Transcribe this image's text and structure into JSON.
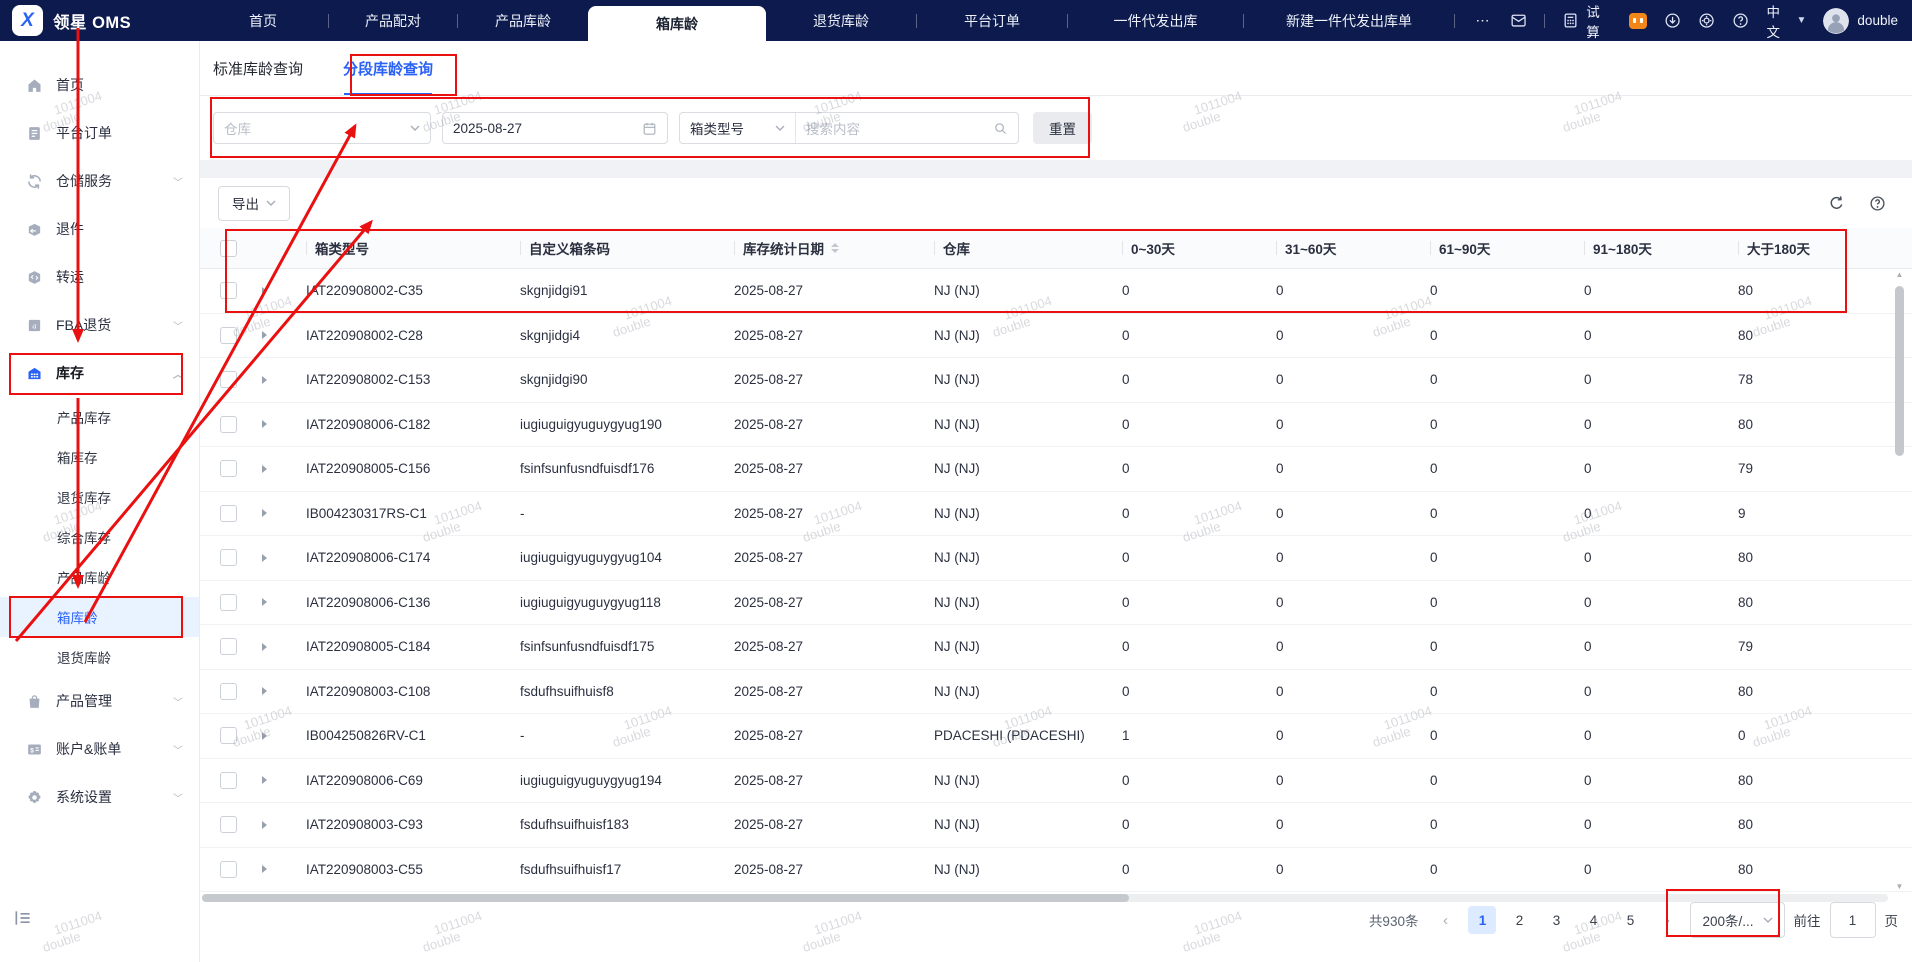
{
  "topbar": {
    "brand": "领星 OMS",
    "tabs": [
      {
        "key": "home",
        "label": "首页"
      },
      {
        "key": "product-pairing",
        "label": "产品配对",
        "sep": true
      },
      {
        "key": "product-age",
        "label": "产品库龄",
        "sep": true
      },
      {
        "key": "box-age",
        "label": "箱库龄",
        "active": true
      },
      {
        "key": "return-age",
        "label": "退货库龄"
      },
      {
        "key": "platform-orders",
        "label": "平台订单",
        "sep": true
      },
      {
        "key": "dropship-outbound",
        "label": "一件代发出库",
        "sep": true
      },
      {
        "key": "new-dropship-outbound",
        "label": "新建一件代发出库单",
        "sep": true
      },
      {
        "key": "more",
        "label": "⋯",
        "sep": true
      }
    ],
    "right": {
      "trial_label": "试算",
      "language": "中文",
      "username": "double"
    }
  },
  "sidebar": {
    "items": [
      {
        "kind": "parent",
        "key": "home",
        "icon": "home",
        "label": "首页"
      },
      {
        "kind": "parent",
        "key": "platform-orders",
        "icon": "orders",
        "label": "平台订单"
      },
      {
        "kind": "parent",
        "key": "warehouse-service",
        "icon": "service",
        "label": "仓储服务",
        "chevron": "down"
      },
      {
        "kind": "parent",
        "key": "returns",
        "icon": "return-box",
        "label": "退件"
      },
      {
        "kind": "parent",
        "key": "transfer",
        "icon": "transfer",
        "label": "转运"
      },
      {
        "kind": "parent",
        "key": "fba-returns",
        "icon": "fba",
        "label": "FBA退货",
        "chevron": "down"
      },
      {
        "kind": "parent",
        "key": "inventory",
        "icon": "inventory",
        "label": "库存",
        "chevron": "up",
        "active": true
      },
      {
        "kind": "sub",
        "key": "product-inventory",
        "label": "产品库存"
      },
      {
        "kind": "sub",
        "key": "box-inventory",
        "label": "箱库存"
      },
      {
        "kind": "sub",
        "key": "return-inventory",
        "label": "退货库存"
      },
      {
        "kind": "sub",
        "key": "combined-inventory",
        "label": "综合库存"
      },
      {
        "kind": "sub",
        "key": "product-age",
        "label": "产品库龄"
      },
      {
        "kind": "sub",
        "key": "box-age",
        "label": "箱库龄",
        "active": true
      },
      {
        "kind": "sub",
        "key": "return-age",
        "label": "退货库龄"
      },
      {
        "kind": "parent",
        "key": "product-management",
        "icon": "bag",
        "label": "产品管理",
        "chevron": "down"
      },
      {
        "kind": "parent",
        "key": "accounts-billing",
        "icon": "billing",
        "label": "账户&账单",
        "chevron": "down"
      },
      {
        "kind": "parent",
        "key": "system-settings",
        "icon": "gear",
        "label": "系统设置",
        "chevron": "down"
      }
    ]
  },
  "page": {
    "tabs": [
      {
        "label": "标准库龄查询"
      },
      {
        "label": "分段库龄查询",
        "active": true
      }
    ],
    "filters": {
      "warehouse_placeholder": "仓库",
      "date_value": "2025-08-27",
      "box_type_label": "箱类型号",
      "search_placeholder": "搜索内容",
      "reset_label": "重置"
    },
    "toolbar": {
      "export_label": "导出"
    }
  },
  "table": {
    "columns": [
      "箱类型号",
      "自定义箱条码",
      "库存统计日期",
      "仓库",
      "0~30天",
      "31~60天",
      "61~90天",
      "91~180天",
      "大于180天"
    ],
    "rows": [
      {
        "box_type": "IAT220908002-C35",
        "barcode": "skgnjidgi91",
        "stat_date": "2025-08-27",
        "warehouse": "NJ (NJ)",
        "d0_30": "0",
        "d31_60": "0",
        "d61_90": "0",
        "d91_180": "0",
        "d_over_180": "80"
      },
      {
        "box_type": "IAT220908002-C28",
        "barcode": "skgnjidgi4",
        "stat_date": "2025-08-27",
        "warehouse": "NJ (NJ)",
        "d0_30": "0",
        "d31_60": "0",
        "d61_90": "0",
        "d91_180": "0",
        "d_over_180": "80"
      },
      {
        "box_type": "IAT220908002-C153",
        "barcode": "skgnjidgi90",
        "stat_date": "2025-08-27",
        "warehouse": "NJ (NJ)",
        "d0_30": "0",
        "d31_60": "0",
        "d61_90": "0",
        "d91_180": "0",
        "d_over_180": "78"
      },
      {
        "box_type": "IAT220908006-C182",
        "barcode": "iugiuguigyuguygyug190",
        "stat_date": "2025-08-27",
        "warehouse": "NJ (NJ)",
        "d0_30": "0",
        "d31_60": "0",
        "d61_90": "0",
        "d91_180": "0",
        "d_over_180": "80"
      },
      {
        "box_type": "IAT220908005-C156",
        "barcode": "fsinfsunfusndfuisdf176",
        "stat_date": "2025-08-27",
        "warehouse": "NJ (NJ)",
        "d0_30": "0",
        "d31_60": "0",
        "d61_90": "0",
        "d91_180": "0",
        "d_over_180": "79"
      },
      {
        "box_type": "IB004230317RS-C1",
        "barcode": "-",
        "stat_date": "2025-08-27",
        "warehouse": "NJ (NJ)",
        "d0_30": "0",
        "d31_60": "0",
        "d61_90": "0",
        "d91_180": "0",
        "d_over_180": "9"
      },
      {
        "box_type": "IAT220908006-C174",
        "barcode": "iugiuguigyuguygyug104",
        "stat_date": "2025-08-27",
        "warehouse": "NJ (NJ)",
        "d0_30": "0",
        "d31_60": "0",
        "d61_90": "0",
        "d91_180": "0",
        "d_over_180": "80"
      },
      {
        "box_type": "IAT220908006-C136",
        "barcode": "iugiuguigyuguygyug118",
        "stat_date": "2025-08-27",
        "warehouse": "NJ (NJ)",
        "d0_30": "0",
        "d31_60": "0",
        "d61_90": "0",
        "d91_180": "0",
        "d_over_180": "80"
      },
      {
        "box_type": "IAT220908005-C184",
        "barcode": "fsinfsunfusndfuisdf175",
        "stat_date": "2025-08-27",
        "warehouse": "NJ (NJ)",
        "d0_30": "0",
        "d31_60": "0",
        "d61_90": "0",
        "d91_180": "0",
        "d_over_180": "79"
      },
      {
        "box_type": "IAT220908003-C108",
        "barcode": "fsdufhsuifhuisf8",
        "stat_date": "2025-08-27",
        "warehouse": "NJ (NJ)",
        "d0_30": "0",
        "d31_60": "0",
        "d61_90": "0",
        "d91_180": "0",
        "d_over_180": "80"
      },
      {
        "box_type": "IB004250826RV-C1",
        "barcode": "-",
        "stat_date": "2025-08-27",
        "warehouse": "PDACESHI (PDACESHI)",
        "d0_30": "1",
        "d31_60": "0",
        "d61_90": "0",
        "d91_180": "0",
        "d_over_180": "0"
      },
      {
        "box_type": "IAT220908006-C69",
        "barcode": "iugiuguigyuguygyug194",
        "stat_date": "2025-08-27",
        "warehouse": "NJ (NJ)",
        "d0_30": "0",
        "d31_60": "0",
        "d61_90": "0",
        "d91_180": "0",
        "d_over_180": "80"
      },
      {
        "box_type": "IAT220908003-C93",
        "barcode": "fsdufhsuifhuisf183",
        "stat_date": "2025-08-27",
        "warehouse": "NJ (NJ)",
        "d0_30": "0",
        "d31_60": "0",
        "d61_90": "0",
        "d91_180": "0",
        "d_over_180": "80"
      },
      {
        "box_type": "IAT220908003-C55",
        "barcode": "fsdufhsuifhuisf17",
        "stat_date": "2025-08-27",
        "warehouse": "NJ (NJ)",
        "d0_30": "0",
        "d31_60": "0",
        "d61_90": "0",
        "d91_180": "0",
        "d_over_180": "80"
      }
    ]
  },
  "pagination": {
    "total_label": "共930条",
    "pages": [
      "1",
      "2",
      "3",
      "4",
      "5"
    ],
    "current_page": "1",
    "page_size_label": "200条/...",
    "goto_label": "前往",
    "goto_value": "1",
    "unit_label": "页"
  },
  "watermark": {
    "line1": "1011004",
    "line2": "double"
  },
  "colors": {
    "primary_blue": "#2a62f5",
    "topbar_navy": "#0c1a4d",
    "annotation_red": "#ea1010",
    "active_sub_bg": "#e9f2ff",
    "robot_orange": "#f08718"
  }
}
